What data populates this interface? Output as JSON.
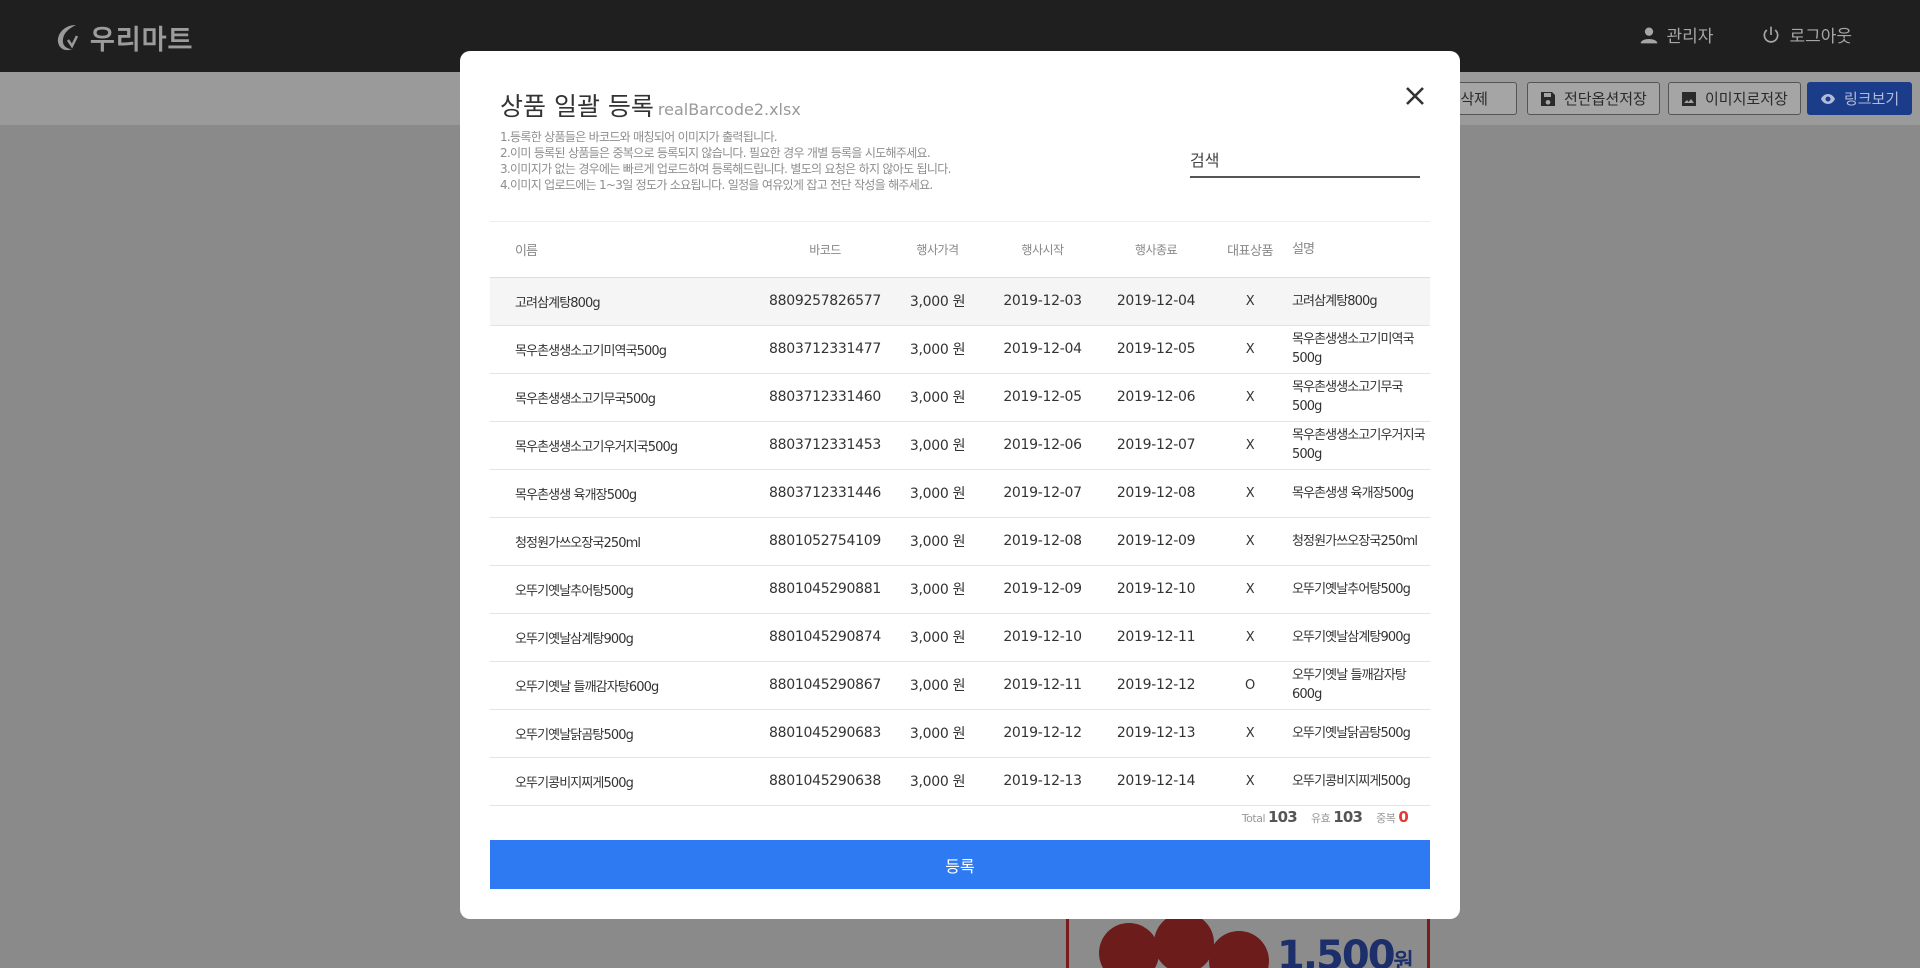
{
  "app": {
    "brand": "우리마트"
  },
  "header": {
    "admin_label": "관리자",
    "logout_label": "로그아웃"
  },
  "toolbar": {
    "delete_all": "모두 삭제",
    "save_options": "전단옵션저장",
    "save_image": "이미지로저장",
    "view_link": "링크보기"
  },
  "background": {
    "price": "1,500",
    "price_unit": "원"
  },
  "modal": {
    "title": "상품 일괄 등록",
    "file_name": "realBarcode2.xlsx",
    "notes": [
      "1.등록한 상품들은 바코드와 매칭되어 이미지가 출력됩니다.",
      "2.이미 등록된 상품들은 중복으로 등록되지 않습니다. 필요한 경우 개별 등록을 시도해주세요.",
      "3.이미지가 없는 경우에는 빠르게 업로드하여 등록해드립니다. 별도의 요청은 하지 않아도 됩니다.",
      "4.이미지 업로드에는 1~3일 정도가 소요됩니다. 일정을 여유있게 잡고 전단 작성을 해주세요."
    ],
    "search_placeholder": "검색",
    "columns": {
      "name": "이름",
      "barcode": "바코드",
      "price": "행사가격",
      "start": "행사시작",
      "end": "행사종료",
      "rep": "대표상품",
      "desc": "설명"
    },
    "rows": [
      {
        "name": "고려삼계탕800g",
        "barcode": "8809257826577",
        "price": "3,000 원",
        "start": "2019-12-03",
        "end": "2019-12-04",
        "rep": "X",
        "desc": "고려삼계탕800g"
      },
      {
        "name": "목우촌생생소고기미역국500g",
        "barcode": "8803712331477",
        "price": "3,000 원",
        "start": "2019-12-04",
        "end": "2019-12-05",
        "rep": "X",
        "desc": "목우촌생생소고기미역국500g"
      },
      {
        "name": "목우촌생생소고기무국500g",
        "barcode": "8803712331460",
        "price": "3,000 원",
        "start": "2019-12-05",
        "end": "2019-12-06",
        "rep": "X",
        "desc": "목우촌생생소고기무국500g"
      },
      {
        "name": "목우촌생생소고기우거지국500g",
        "barcode": "8803712331453",
        "price": "3,000 원",
        "start": "2019-12-06",
        "end": "2019-12-07",
        "rep": "X",
        "desc": "목우촌생생소고기우거지국500g"
      },
      {
        "name": "목우촌생생 육개장500g",
        "barcode": "8803712331446",
        "price": "3,000 원",
        "start": "2019-12-07",
        "end": "2019-12-08",
        "rep": "X",
        "desc": "목우촌생생 육개장500g"
      },
      {
        "name": "청정원가쓰오장국250ml",
        "barcode": "8801052754109",
        "price": "3,000 원",
        "start": "2019-12-08",
        "end": "2019-12-09",
        "rep": "X",
        "desc": "청정원가쓰오장국250ml"
      },
      {
        "name": "오뚜기옛날추어탕500g",
        "barcode": "8801045290881",
        "price": "3,000 원",
        "start": "2019-12-09",
        "end": "2019-12-10",
        "rep": "X",
        "desc": "오뚜기옛날추어탕500g"
      },
      {
        "name": "오뚜기옛날삼계탕900g",
        "barcode": "8801045290874",
        "price": "3,000 원",
        "start": "2019-12-10",
        "end": "2019-12-11",
        "rep": "X",
        "desc": "오뚜기옛날삼계탕900g"
      },
      {
        "name": "오뚜기옛날 들깨감자탕600g",
        "barcode": "8801045290867",
        "price": "3,000 원",
        "start": "2019-12-11",
        "end": "2019-12-12",
        "rep": "O",
        "desc": "오뚜기옛날 들깨감자탕600g"
      },
      {
        "name": "오뚜기옛날닭곰탕500g",
        "barcode": "8801045290683",
        "price": "3,000 원",
        "start": "2019-12-12",
        "end": "2019-12-13",
        "rep": "X",
        "desc": "오뚜기옛날닭곰탕500g"
      },
      {
        "name": "오뚜기콩비지찌게500g",
        "barcode": "8801045290638",
        "price": "3,000 원",
        "start": "2019-12-13",
        "end": "2019-12-14",
        "rep": "X",
        "desc": "오뚜기콩비지찌게500g"
      }
    ],
    "summary": {
      "total_label": "Total",
      "total_value": "103",
      "valid_label": "유효",
      "valid_value": "103",
      "dup_label": "중복",
      "dup_value": "0"
    },
    "submit_label": "등록"
  },
  "colors": {
    "accent": "#2d7af3",
    "duplicate": "#e53935",
    "topbar": "#1f1f1f"
  }
}
